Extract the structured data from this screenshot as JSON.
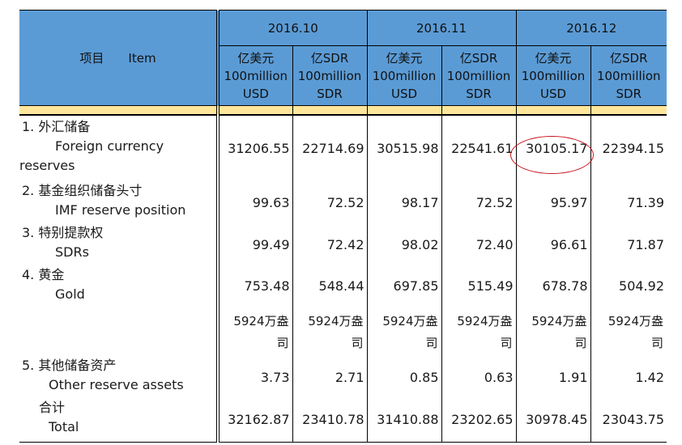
{
  "header": {
    "item_label": "项目　　Item",
    "periods": [
      "2016.10",
      "2016.11",
      "2016.12"
    ],
    "unit_usd": [
      "亿美元",
      "100million",
      "USD"
    ],
    "unit_sdr": [
      "亿SDR",
      "100million",
      "SDR"
    ]
  },
  "rows": [
    {
      "zh": "1.  外汇储备",
      "en": "Foreign currency",
      "en2": "reserves",
      "values": [
        "31206.55",
        "22714.69",
        "30515.98",
        "22541.61",
        "30105.17",
        "22394.15"
      ]
    },
    {
      "zh": "2.  基金组织储备头寸",
      "en": "IMF reserve position",
      "values": [
        "99.63",
        "72.52",
        "98.17",
        "72.52",
        "95.97",
        "71.39"
      ]
    },
    {
      "zh": "3.  特别提款权",
      "en": "SDRs",
      "values": [
        "99.49",
        "72.42",
        "98.02",
        "72.40",
        "96.61",
        "71.87"
      ]
    },
    {
      "zh": "4.  黄金",
      "en": "Gold",
      "values": [
        "753.48",
        "548.44",
        "697.85",
        "515.49",
        "678.78",
        "504.92"
      ]
    },
    {
      "zh": "5.  其他储备资产",
      "en": "Other reserve assets",
      "values": [
        "3.73",
        "2.71",
        "0.85",
        "0.63",
        "1.91",
        "1.42"
      ]
    },
    {
      "zh": "合计",
      "en": "Total",
      "values": [
        "32162.87",
        "23410.78",
        "31410.88",
        "23202.65",
        "30978.45",
        "23043.75"
      ]
    }
  ],
  "gold_weight": [
    "5924万盎",
    "司"
  ],
  "accent_colors": {
    "header": "#5b9bd5",
    "band": "#ffe69a",
    "circle": "#c8141c"
  }
}
